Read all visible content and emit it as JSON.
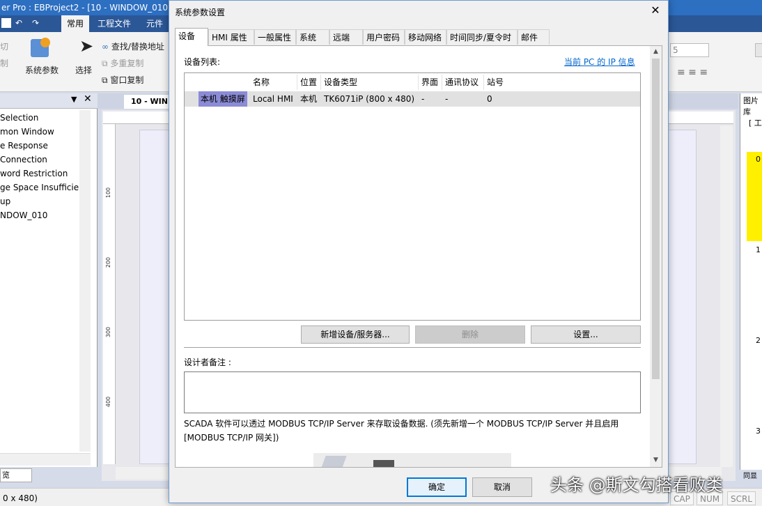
{
  "app": {
    "title": "er Pro : EBProject2 - [10 - WINDOW_010 ]",
    "ribbon_tabs": [
      "常用",
      "工程文件",
      "元件"
    ],
    "ribbon": {
      "cut": "切",
      "copy": "制",
      "system_params": "系统参数",
      "select": "选择",
      "find_replace": "查找/替换地址",
      "multi_copy": "多重复制",
      "window_copy": "窗口复制",
      "font_size": "5"
    },
    "tree_items": [
      "Selection",
      "mon Window",
      "e Response",
      "Connection",
      "word Restriction",
      "ge Space Insufficier",
      "up",
      "NDOW_010"
    ],
    "left_bottom_tab": "览",
    "doc_tab": "10 - WIN",
    "ruler_marks": [
      "100",
      "200",
      "300",
      "400"
    ],
    "right_panel": {
      "header": "图片库",
      "tool": "[ 工",
      "items": [
        "0",
        "1",
        "2",
        "3"
      ],
      "bottom": "同显"
    },
    "status": {
      "resolution": "0 x 480)",
      "cap": "CAP",
      "num": "NUM",
      "scrl": "SCRL"
    }
  },
  "dialog": {
    "title": "系统参数设置",
    "close_glyph": "✕",
    "tabs": [
      "设备",
      "HMI 属性",
      "一般属性",
      "系统",
      "远端",
      "用户密码",
      "移动网络",
      "时间同步/夏令时",
      "邮件"
    ],
    "device_list_label": "设备列表:",
    "pc_ip_link": "当前 PC 的 IP 信息",
    "table": {
      "headers": [
        "名称",
        "位置",
        "设备类型",
        "界面",
        "通讯协议",
        "站号"
      ],
      "rows": [
        {
          "prefix": "本机 触摸屏",
          "name": "Local HMI",
          "location": "本机",
          "device_type": "TK6071iP (800 x 480)",
          "interface": "-",
          "protocol": "-",
          "station": "0"
        }
      ]
    },
    "buttons": {
      "add": "新增设备/服务器...",
      "delete": "删除",
      "settings": "设置..."
    },
    "notes_label": "设计者备注 :",
    "notes_value": "",
    "scada_note": "SCADA 软件可以透过 MODBUS TCP/IP Server 来存取设备数据. (须先新增一个 MODBUS TCP/IP Server 并且启用 [MODBUS TCP/IP 网关])",
    "ok": "确定",
    "cancel": "取消"
  },
  "watermark": "头条 @斯文勾搭看败类"
}
